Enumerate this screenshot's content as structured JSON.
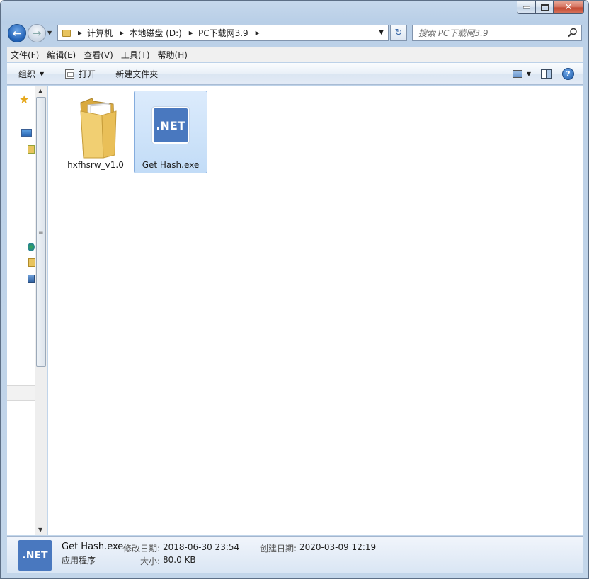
{
  "address": {
    "crumbs": [
      "计算机",
      "本地磁盘 (D:)",
      "PC下载网3.9"
    ]
  },
  "search": {
    "placeholder": "搜索 PC下载网3.9"
  },
  "menu": [
    "文件(F)",
    "编辑(E)",
    "查看(V)",
    "工具(T)",
    "帮助(H)"
  ],
  "commands": {
    "organize": "组织",
    "open": "打开",
    "new_folder": "新建文件夹"
  },
  "files": [
    {
      "name": "hxfhsrw_v1.0",
      "kind": "folder",
      "selected": false
    },
    {
      "name": "Get Hash.exe",
      "kind": "dotnet",
      "selected": true,
      "icon_text": ".NET"
    }
  ],
  "details": {
    "icon_text": ".NET",
    "name": "Get Hash.exe",
    "type": "应用程序",
    "modified_label": "修改日期:",
    "modified_value": "2018-06-30 23:54",
    "size_label": "大小:",
    "size_value": "80.0 KB",
    "created_label": "创建日期:",
    "created_value": "2020-03-09 12:19"
  },
  "colors": {
    "dotnet_blue": "#4978bf",
    "selection": "#c2dcf7",
    "folder": "#e8c45e"
  },
  "window_title_glyphs": {
    "close": "✕"
  }
}
